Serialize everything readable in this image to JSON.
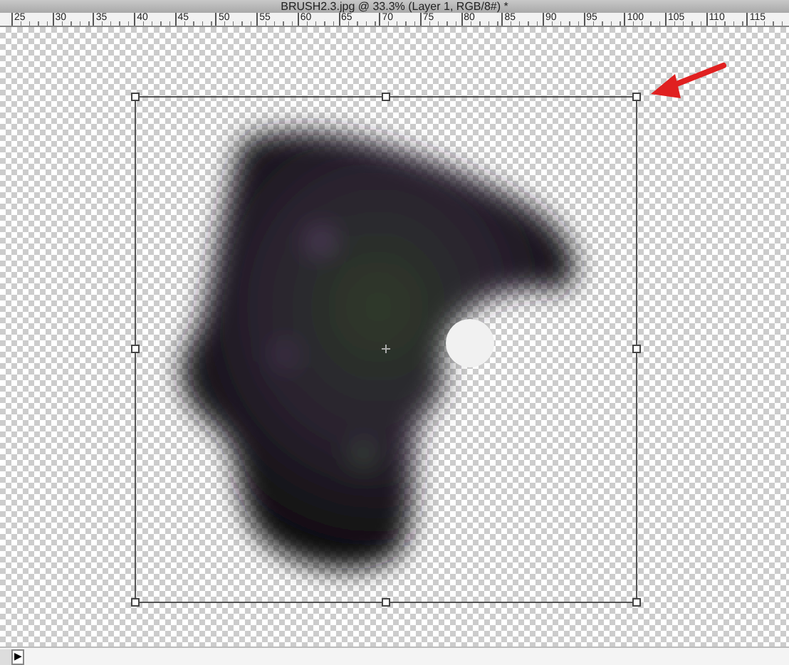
{
  "window": {
    "title": "BRUSH2.3.jpg @ 33.3% (Layer 1, RGB/8#) *"
  },
  "ruler": {
    "labels": [
      "25",
      "30",
      "35",
      "40",
      "45",
      "50",
      "55",
      "60",
      "65",
      "70",
      "75",
      "80",
      "85",
      "90",
      "95",
      "100",
      "105",
      "110",
      "115"
    ]
  },
  "status_bar": {
    "scroll_button": "▶"
  }
}
